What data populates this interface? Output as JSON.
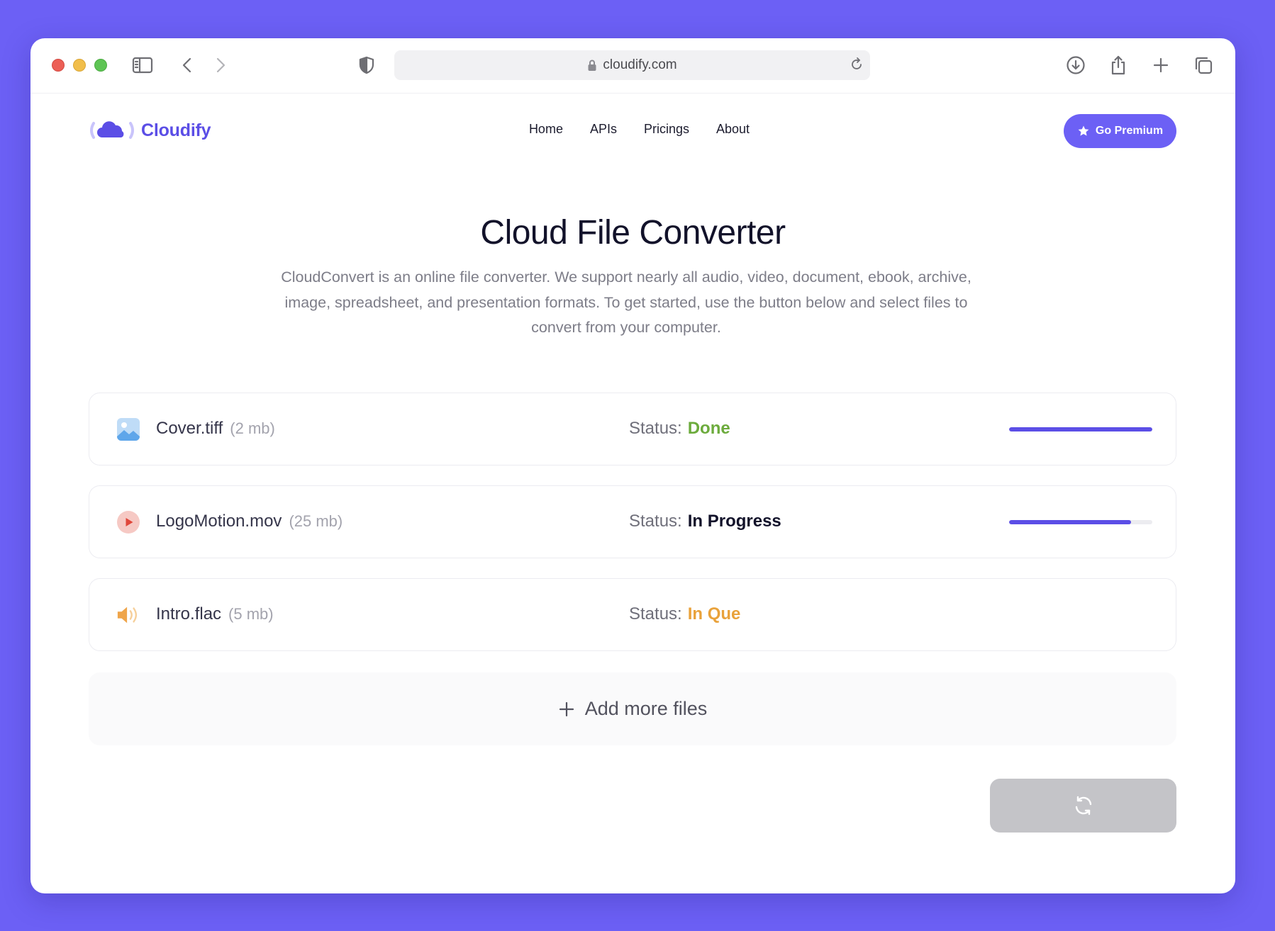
{
  "browser": {
    "url": "cloudify.com"
  },
  "brand": {
    "name": "Cloudify",
    "accent": "#5b4ee6"
  },
  "nav": {
    "items": [
      "Home",
      "APIs",
      "Pricings",
      "About"
    ]
  },
  "cta": {
    "label": "Go Premium"
  },
  "hero": {
    "title": "Cloud File Converter",
    "description": "CloudConvert is an online file converter. We support nearly all audio, video, document, ebook, archive, image, spreadsheet, and presentation formats. To get started, use the button below and select files to convert from your computer."
  },
  "files": [
    {
      "name": "Cover.tiff",
      "size": "(2 mb)",
      "status_label": "Status:",
      "status": "Done",
      "status_color": "#6cab3c",
      "icon": "image-file-icon",
      "progress": 1.0
    },
    {
      "name": "LogoMotion.mov",
      "size": "(25 mb)",
      "status_label": "Status:",
      "status": "In Progress",
      "status_color": "#12122a",
      "icon": "video-file-icon",
      "progress": 0.85
    },
    {
      "name": "Intro.flac",
      "size": "(5 mb)",
      "status_label": "Status:",
      "status": "In Que",
      "status_color": "#e9a23b",
      "icon": "audio-file-icon",
      "progress": null
    }
  ],
  "add_files": {
    "label": "Add more files"
  },
  "convert_button": {
    "icon": "refresh-icon",
    "state": "disabled"
  }
}
